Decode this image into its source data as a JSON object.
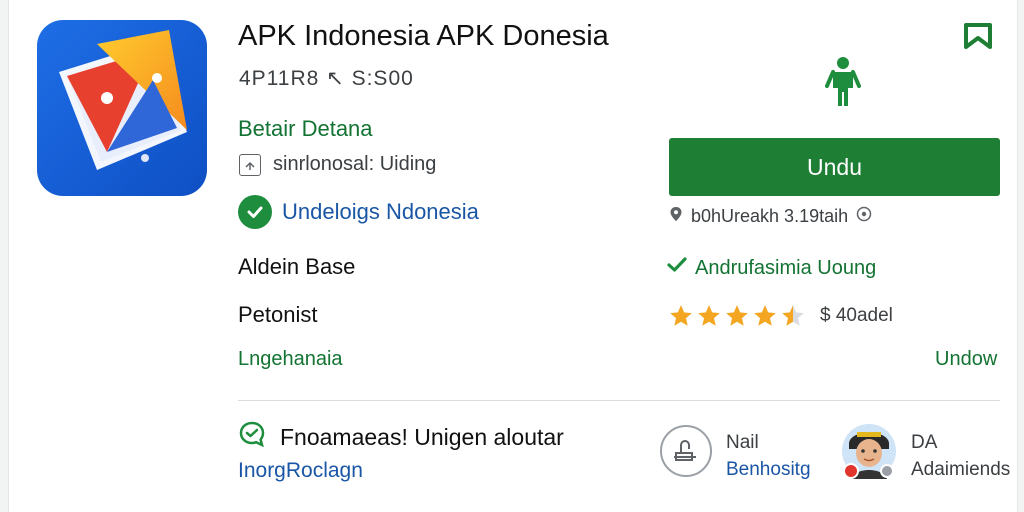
{
  "app": {
    "title": "APK Indonesia APK Donesia",
    "meta": "4P11R8 ↖ S:S00",
    "developer": "Betair Detana",
    "rating_text": "sinrlonosal: Uiding",
    "verified_text": "Undeloigs Ndonesia",
    "labels": [
      "Aldein Base",
      "Petonist"
    ],
    "green_link": "Lngehanaia",
    "right_link": "Undow"
  },
  "install": {
    "button_label": "Undu",
    "size_text": "b0hUreakh 3.19taih",
    "feature_text": "Andrufasimia Uoung",
    "rating_value": 4.5,
    "rating_label": "$ 40adel"
  },
  "footer": {
    "title": "Fnoamaeas! Unigen aloutar",
    "link": "InorgRoclagn",
    "item1_top": "Nail",
    "item1_bottom": "Benhositg",
    "item2_top": "DA",
    "item2_bottom": "Adaimiends"
  },
  "icons": {
    "bookmark": "bookmark-icon",
    "person": "person-icon",
    "box": "box-icon",
    "check": "check-circle-icon",
    "location": "location-icon",
    "info": "info-icon",
    "checkmark": "checkmark-icon",
    "star": "star-icon",
    "chat": "chat-icon",
    "message": "message-circle-icon",
    "avatar": "avatar-icon"
  },
  "colors": {
    "primary_green": "#1e7e34",
    "text_green": "#137333",
    "text_blue": "#1a56a6",
    "star": "#f4a622"
  }
}
